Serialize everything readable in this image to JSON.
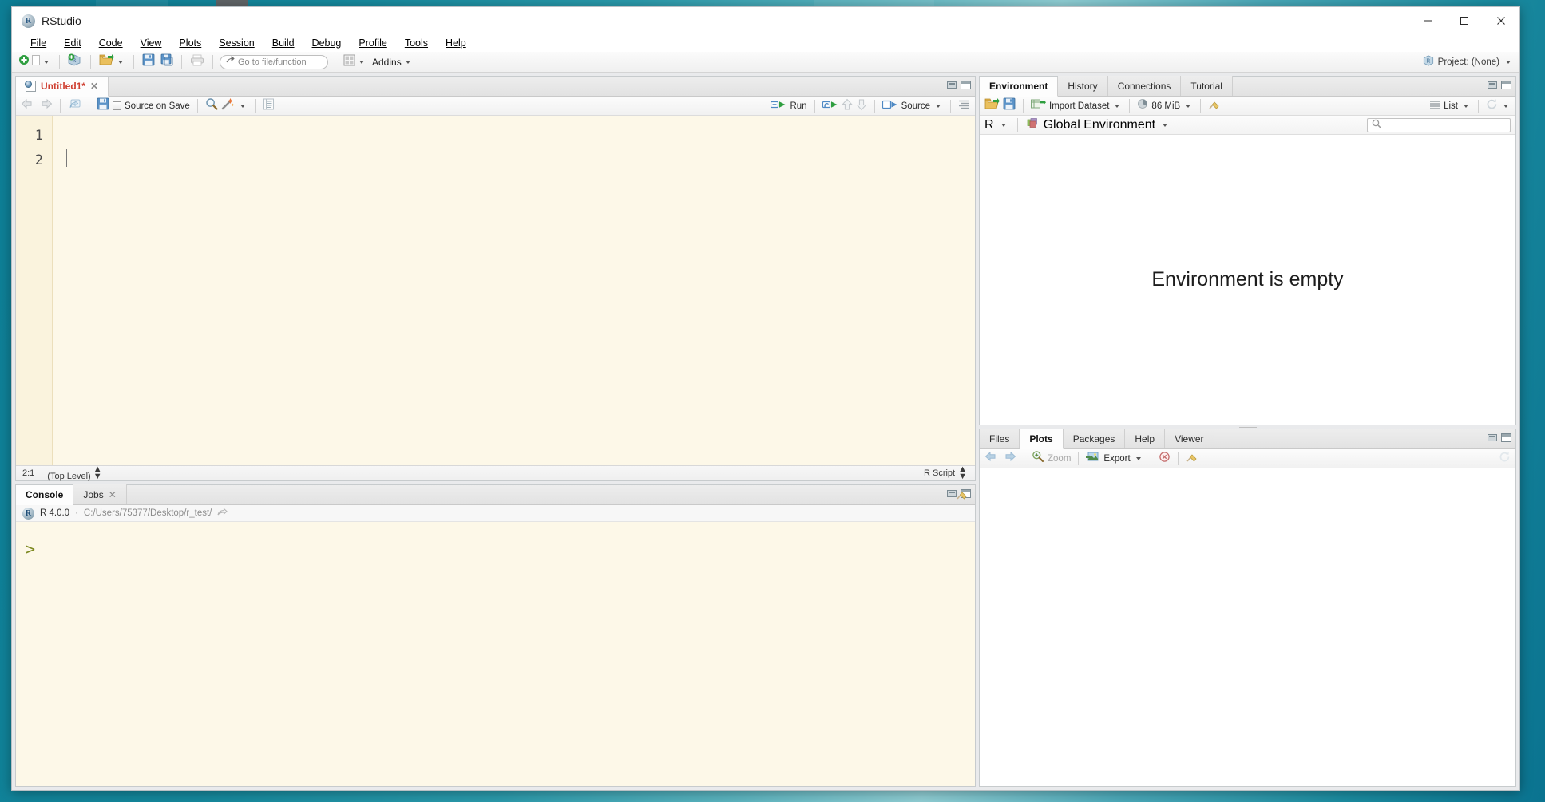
{
  "window": {
    "title": "RStudio",
    "app_icon": "r-logo-icon",
    "controls": {
      "minimize": "minimize-icon",
      "maximize": "maximize-icon",
      "close": "close-icon"
    }
  },
  "menubar": {
    "items": [
      {
        "label": "File",
        "accel": "F"
      },
      {
        "label": "Edit",
        "accel": "E"
      },
      {
        "label": "Code",
        "accel": "C"
      },
      {
        "label": "View",
        "accel": "V"
      },
      {
        "label": "Plots",
        "accel": "P"
      },
      {
        "label": "Session",
        "accel": "S"
      },
      {
        "label": "Build",
        "accel": "B"
      },
      {
        "label": "Debug",
        "accel": "D"
      },
      {
        "label": "Profile",
        "accel": "P"
      },
      {
        "label": "Tools",
        "accel": "T"
      },
      {
        "label": "Help",
        "accel": "H"
      }
    ]
  },
  "toolbar": {
    "new_file_icon": "new-file-icon",
    "new_project_icon": "new-project-icon",
    "open_file_icon": "open-folder-icon",
    "save_icon": "save-icon",
    "save_all_icon": "save-all-icon",
    "print_icon": "print-icon",
    "goto_placeholder": "Go to file/function",
    "goto_value": "",
    "goto_icon": "goto-arrow-icon",
    "workspace_panes_icon": "panes-layout-icon",
    "addins_label": "Addins",
    "project_label": "Project: (None)",
    "project_icon": "r-project-icon"
  },
  "source_pane": {
    "tabs": [
      {
        "label": "Untitled1*",
        "active": true,
        "closable": true,
        "modified": true
      }
    ],
    "toolbar": {
      "back_icon": "arrow-left-icon",
      "forward_icon": "arrow-right-icon",
      "popout_icon": "show-in-new-window-icon",
      "save_icon": "save-icon",
      "source_on_save_label": "Source on Save",
      "source_on_save_checked": false,
      "find_icon": "search-icon",
      "magic_icon": "code-tools-icon",
      "compile_report_icon": "compile-notebook-icon",
      "run_label": "Run",
      "run_icon": "run-icon",
      "rerun_icon": "rerun-icon",
      "prev_chunk_icon": "arrow-up-icon",
      "next_chunk_icon": "arrow-down-icon",
      "source_label": "Source",
      "source_icon": "source-icon",
      "outline_icon": "document-outline-icon"
    },
    "editor": {
      "line_numbers": [
        "1",
        "2"
      ],
      "lines": [
        "",
        ""
      ],
      "background_color": "#fdf8e8",
      "gutter_color": "#faf3dd"
    },
    "statusbar": {
      "cursor_position": "2:1",
      "scope": "(Top Level)",
      "file_type": "R Script"
    }
  },
  "console_pane": {
    "tabs": [
      {
        "label": "Console",
        "active": true,
        "closable": false
      },
      {
        "label": "Jobs",
        "active": false,
        "closable": true
      }
    ],
    "info": {
      "r_version": "R 4.0.0",
      "separator": "·",
      "working_directory": "C:/Users/75377/Desktop/r_test/",
      "popout_icon": "view-in-pane-icon"
    },
    "prompt": ">",
    "clear_icon": "broom-icon",
    "background_color": "#fdf8e8"
  },
  "environment_pane": {
    "tabs": [
      {
        "label": "Environment",
        "active": true
      },
      {
        "label": "History",
        "active": false
      },
      {
        "label": "Connections",
        "active": false
      },
      {
        "label": "Tutorial",
        "active": false
      }
    ],
    "toolbar": {
      "load_icon": "open-folder-icon",
      "save_icon": "save-icon",
      "import_dataset_label": "Import Dataset",
      "memory_label": "86 MiB",
      "memory_icon": "memory-pie-icon",
      "clear_icon": "broom-icon",
      "view_mode_label": "List",
      "view_mode_icon": "list-view-icon",
      "refresh_icon": "refresh-icon"
    },
    "filter_row": {
      "language": "R",
      "scope": "Global Environment",
      "scope_icon": "environment-cube-icon",
      "search_placeholder": "",
      "search_icon": "search-icon"
    },
    "empty_message": "Environment is empty"
  },
  "files_pane": {
    "tabs": [
      {
        "label": "Files",
        "active": false
      },
      {
        "label": "Plots",
        "active": true
      },
      {
        "label": "Packages",
        "active": false
      },
      {
        "label": "Help",
        "active": false
      },
      {
        "label": "Viewer",
        "active": false
      }
    ],
    "toolbar": {
      "back_icon": "arrow-left-icon",
      "forward_icon": "arrow-right-icon",
      "zoom_label": "Zoom",
      "zoom_icon": "zoom-icon",
      "export_label": "Export",
      "export_icon": "export-image-icon",
      "remove_icon": "remove-plot-icon",
      "clear_all_icon": "broom-icon",
      "publish_icon": "publish-icon"
    }
  },
  "colors": {
    "editor_background": "#fdf8e8",
    "gutter_background": "#faf3dd",
    "pane_chrome": "#e9eaec",
    "accent_green": "#3f9a3f",
    "accent_blue": "#4e89c4",
    "modified_tab_text": "#cf4032",
    "prompt_green": "#7e8a22",
    "desktop": "#0f8399"
  }
}
